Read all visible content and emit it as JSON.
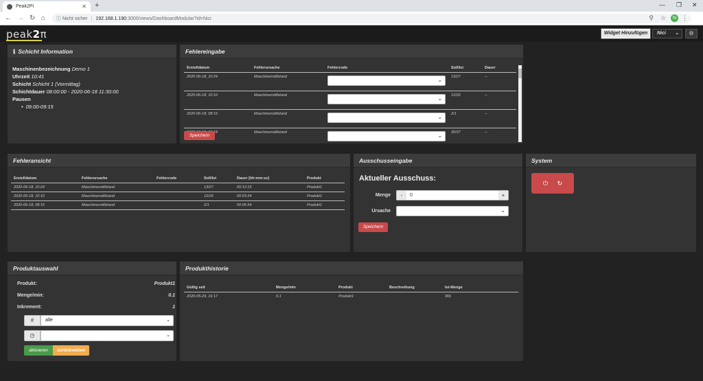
{
  "browser": {
    "tab_title": "Peak2Pi",
    "security_label": "Nicht sicher",
    "url_host": "192.168.1.190",
    "url_rest": ":3000/views/DashboardModular?id=Nici",
    "avatar_letter": "N"
  },
  "header": {
    "logo_prefix": "peak",
    "logo_main": "2",
    "logo_suffix": "π",
    "add_widget_label": "Widget Hinzufügen",
    "user": "Nici"
  },
  "schicht": {
    "title": "Schicht Information",
    "machine_label": "Maschinenbezeichnung",
    "machine_value": "Demo 1",
    "time_label": "Uhrzeit",
    "time_value": "10:41",
    "shift_label": "Schicht",
    "shift_value": "Schicht 1 (Vormittag)",
    "duration_label": "Schichtdauer",
    "duration_value": "08:00:00 - 2020-06-18 11:30:00",
    "pauses_label": "Pausen",
    "pauses": [
      "09:00-09:15"
    ]
  },
  "fehlereingabe": {
    "title": "Fehlereingabe",
    "columns": [
      "Erstelldatum",
      "Fehlerursache",
      "Fehlercode",
      "Soll/Ist",
      "Dauer"
    ],
    "rows": [
      {
        "date": "2020-06-18, 10:24",
        "cause": "Maschinenstillstand",
        "ratio": "13/27",
        "duration": "--"
      },
      {
        "date": "2020-06-18, 10:10",
        "cause": "Maschinenstillstand",
        "ratio": "12/26",
        "duration": "--"
      },
      {
        "date": "2020-06-18, 08:15",
        "cause": "Maschinenstillstand",
        "ratio": "2/1",
        "duration": "--"
      },
      {
        "date": "2020-06-18, 08:18",
        "cause": "Maschinenstillstand",
        "ratio": "30/37",
        "duration": "--"
      }
    ],
    "save_label": "Speichern"
  },
  "fehleransicht": {
    "title": "Fehleransicht",
    "columns": [
      "Erstelldatum",
      "Fehlerursache",
      "Fehlercode",
      "Soll/Ist",
      "Dauer [hh:mm:ss]",
      "Produkt"
    ],
    "rows": [
      {
        "date": "2020-06-18, 10:24",
        "cause": "Maschinenstillstand",
        "code": "",
        "ratio": "13/27",
        "duration": "00:12:15",
        "product": "Produkt1"
      },
      {
        "date": "2020-06-18, 10:10",
        "cause": "Maschinenstillstand",
        "code": "",
        "ratio": "12/26",
        "duration": "00:03:34",
        "product": "Produkt1"
      },
      {
        "date": "2020-06-18, 08:15",
        "cause": "Maschinenstillstand",
        "code": "",
        "ratio": "2/1",
        "duration": "00:06:34",
        "product": "Produkt1"
      }
    ]
  },
  "ausschuss": {
    "title": "Ausschusseingabe",
    "heading": "Aktueller Ausschuss:",
    "menge_label": "Menge",
    "menge_value": "0",
    "minus": "-",
    "plus": "+",
    "ursache_label": "Ursache",
    "save_label": "Speichern"
  },
  "system": {
    "title": "System"
  },
  "produktauswahl": {
    "title": "Produktauswahl",
    "product_label": "Produkt:",
    "product_value": "Produkt1",
    "rate_label": "Menge/min:",
    "rate_value": "0.1",
    "increment_label": "Inkrement:",
    "increment_value": "1",
    "hash_addon": "#",
    "select_value": "alle",
    "activate_label": "aktivieren",
    "reset_label": "zurücksetzen"
  },
  "produkthistorie": {
    "title": "Produkthistorie",
    "columns": [
      "Gültig seit",
      "Menge/min",
      "Produkt",
      "Beschreibung",
      "Ist-Menge"
    ],
    "rows": [
      {
        "since": "2020-05-29, 16:17",
        "rate": "0.1",
        "product": "Produkt1",
        "desc": "",
        "qty": "365"
      }
    ]
  }
}
